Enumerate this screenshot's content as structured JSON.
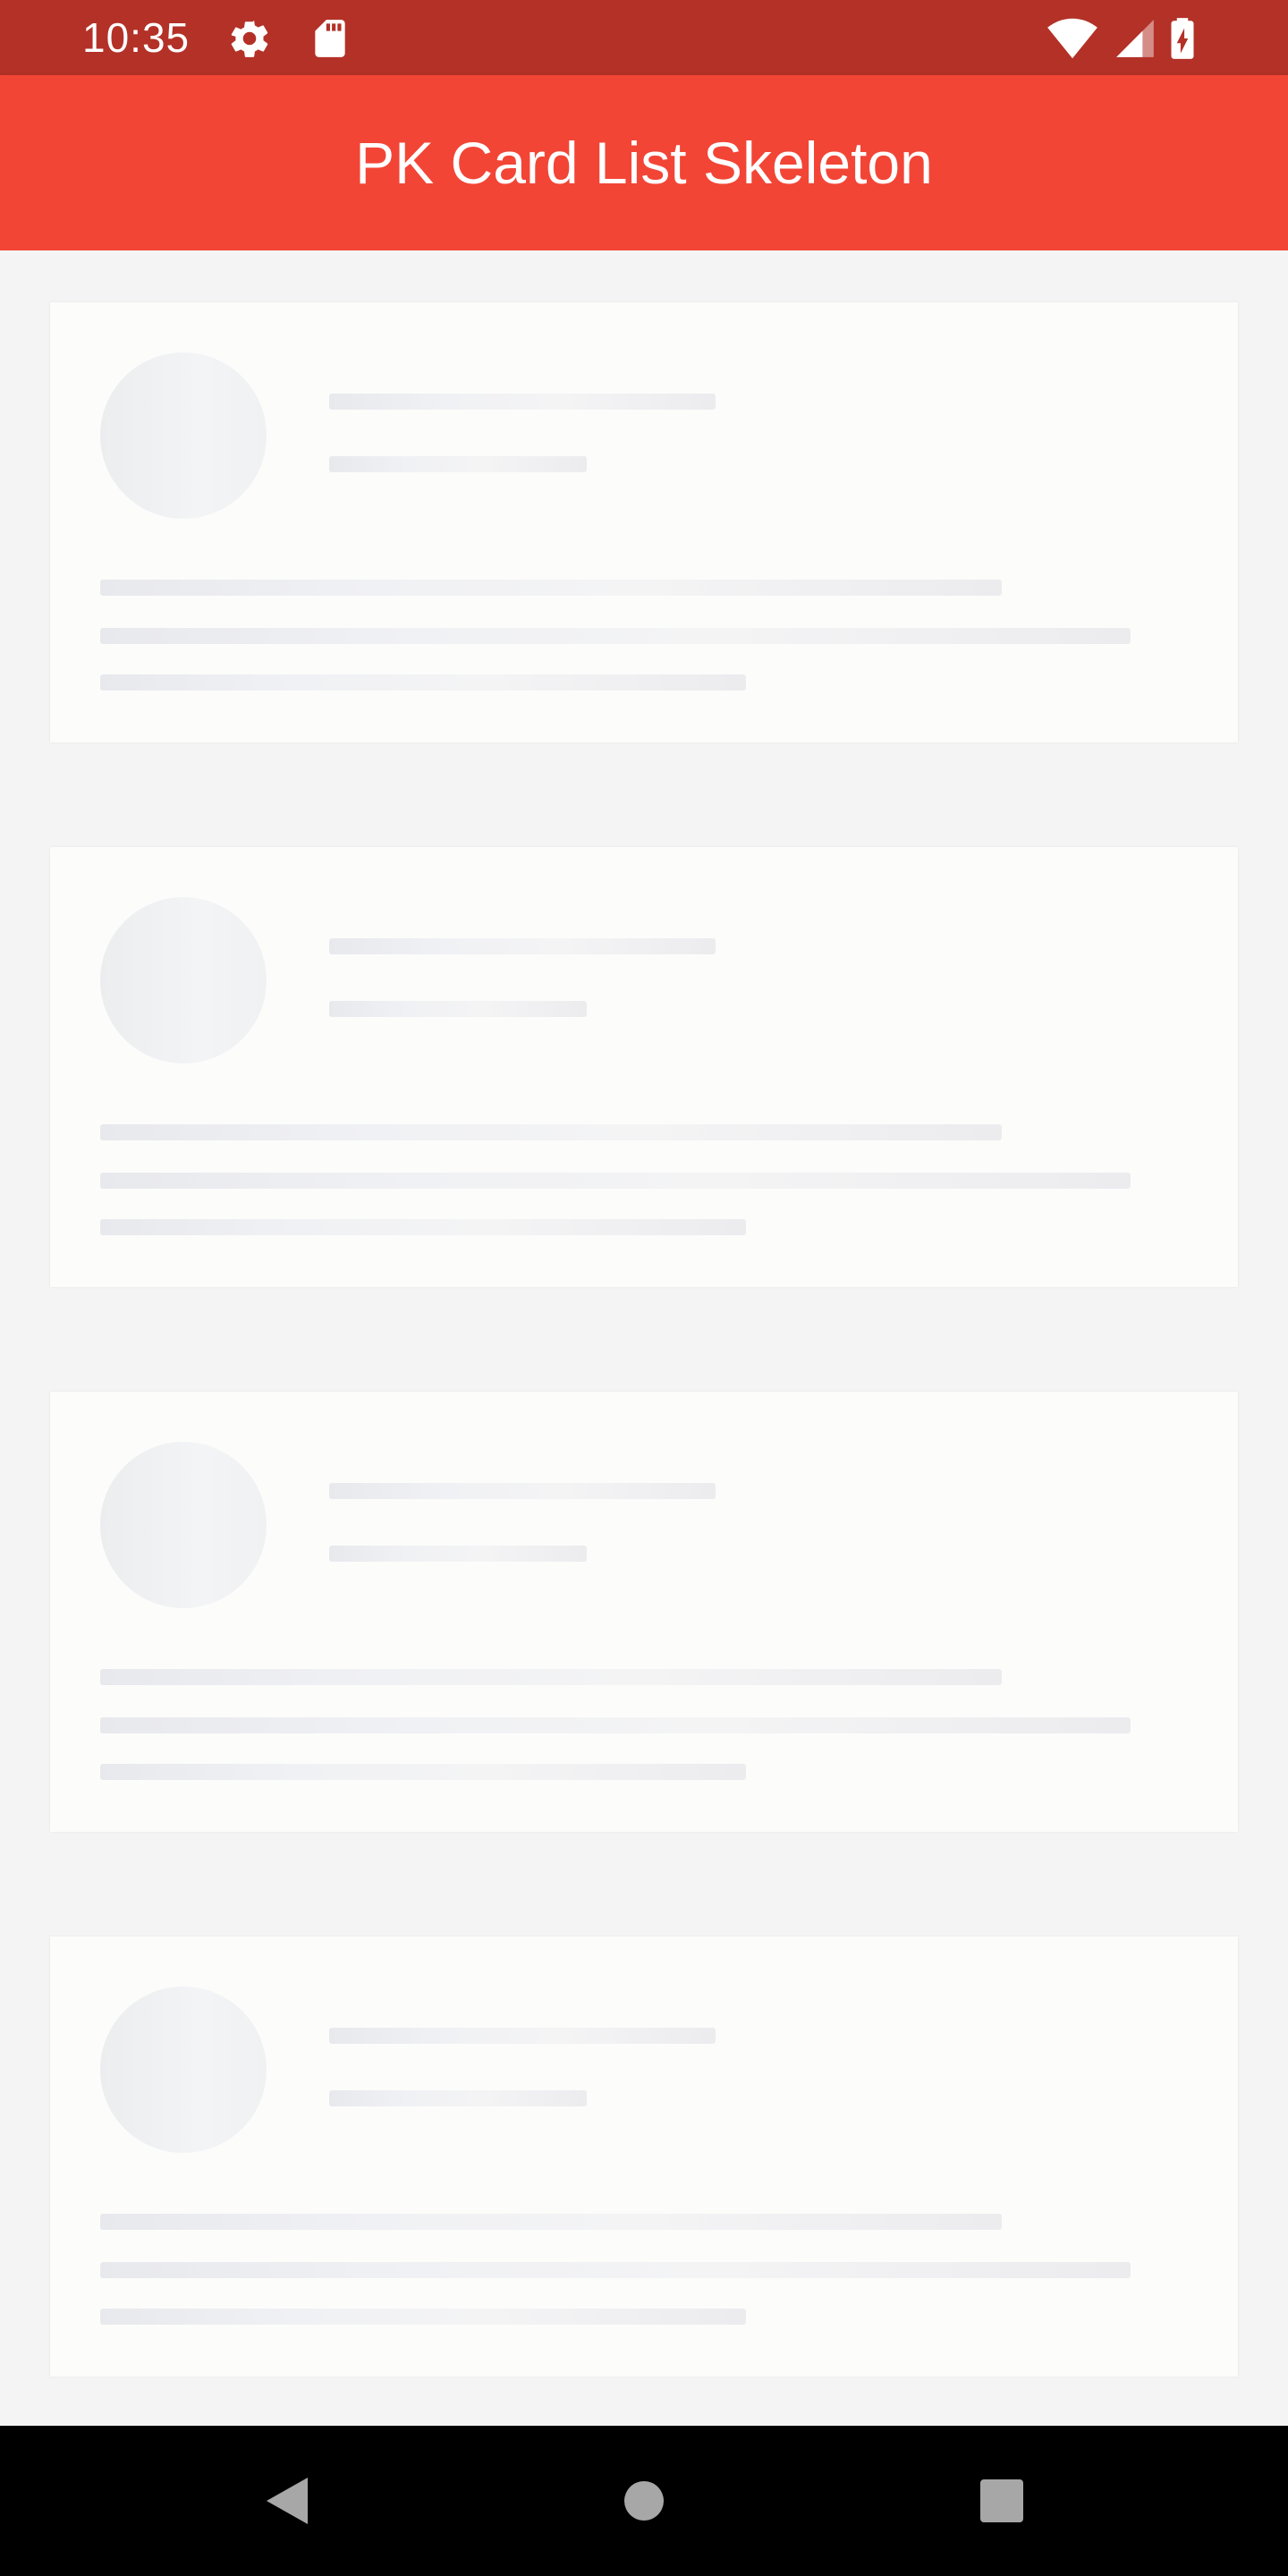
{
  "status_bar": {
    "time": "10:35",
    "icons": [
      "gear-icon",
      "sd-card-icon",
      "wifi-icon",
      "cellular-signal-icon",
      "battery-charging-icon"
    ]
  },
  "app_bar": {
    "title": "PK Card List Skeleton"
  },
  "skeleton_cards": {
    "count": 4,
    "state": "loading"
  },
  "navigation_bar": {
    "buttons": [
      "back-icon",
      "home-icon",
      "recents-icon"
    ]
  },
  "colors": {
    "status_bar": "#b33127",
    "app_bar": "#f24536",
    "background": "#f4f4f4",
    "card": "#fcfcfb",
    "skeleton": "#ecedf0",
    "nav_bar": "#000000"
  }
}
